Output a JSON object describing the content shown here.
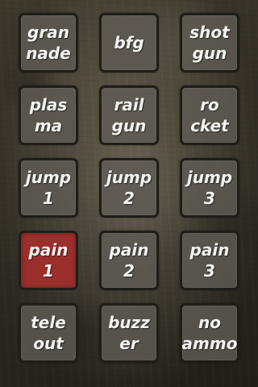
{
  "colors": {
    "background": "#5c5544",
    "button": "#5f5c54",
    "button_active": "#9b2f2b",
    "button_border": "#1f1d18",
    "label": "#f2f2f0"
  },
  "buttons": [
    {
      "label": "gran\nnade",
      "active": false
    },
    {
      "label": "bfg",
      "active": false
    },
    {
      "label": "shot\ngun",
      "active": false
    },
    {
      "label": "plas\nma",
      "active": false
    },
    {
      "label": "rail\ngun",
      "active": false
    },
    {
      "label": "ro\ncket",
      "active": false
    },
    {
      "label": "jump\n1",
      "active": false
    },
    {
      "label": "jump\n2",
      "active": false
    },
    {
      "label": "jump\n3",
      "active": false
    },
    {
      "label": "pain\n1",
      "active": true
    },
    {
      "label": "pain\n2",
      "active": false
    },
    {
      "label": "pain\n3",
      "active": false
    },
    {
      "label": "tele\nout",
      "active": false
    },
    {
      "label": "buzz\ner",
      "active": false
    },
    {
      "label": "no\nammo",
      "active": false
    }
  ]
}
